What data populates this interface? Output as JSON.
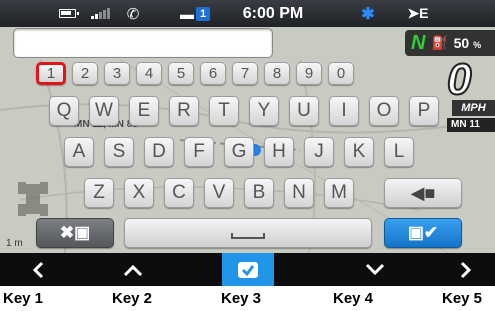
{
  "status_bar": {
    "time": "6:00 PM",
    "network": "➤E",
    "message_count": "1",
    "icons": [
      "battery-icon",
      "signal-icon",
      "phone-icon",
      "message-icon",
      "bluetooth-icon",
      "network-icon"
    ]
  },
  "text_input": {
    "value": ""
  },
  "indicators": {
    "fuel_brand": "N",
    "fuel_percent": "50",
    "fuel_unit": "%",
    "speed_digit": "0",
    "speed_unit": "MPH",
    "route_label": "MN 11",
    "street_label": "MN 11, MN 89",
    "scale_label": "1 m"
  },
  "keyboard": {
    "number_row": [
      "1",
      "2",
      "3",
      "4",
      "5",
      "6",
      "7",
      "8",
      "9",
      "0"
    ],
    "selected_key": "1",
    "row1": [
      "Q",
      "W",
      "E",
      "R",
      "T",
      "Y",
      "U",
      "I",
      "O",
      "P"
    ],
    "row2": [
      "A",
      "S",
      "D",
      "F",
      "G",
      "H",
      "J",
      "K",
      "L"
    ],
    "row3": [
      "Z",
      "X",
      "C",
      "V",
      "B",
      "N",
      "M"
    ],
    "backspace_icon": "backspace-arrow-icon",
    "delete_icon": "delete-save-icon",
    "space_icon": "space-bar-icon",
    "save_icon": "save-confirm-icon"
  },
  "nav": {
    "items": [
      {
        "icon": "chevron-left-icon",
        "glyph": "‹",
        "active": false
      },
      {
        "icon": "chevron-up-icon",
        "glyph": "^",
        "active": false
      },
      {
        "icon": "confirm-icon",
        "glyph": "✔",
        "active": true
      },
      {
        "icon": "chevron-down-icon",
        "glyph": "v",
        "active": false
      },
      {
        "icon": "chevron-right-icon",
        "glyph": "›",
        "active": false
      }
    ]
  },
  "key_labels": [
    "Key 1",
    "Key 2",
    "Key 3",
    "Key 4",
    "Key 5"
  ],
  "colors": {
    "accent": "#2196e8",
    "selected_border": "#e0151b",
    "fuel_green": "#2fcf3a",
    "status_bar": "#2a2d31"
  }
}
